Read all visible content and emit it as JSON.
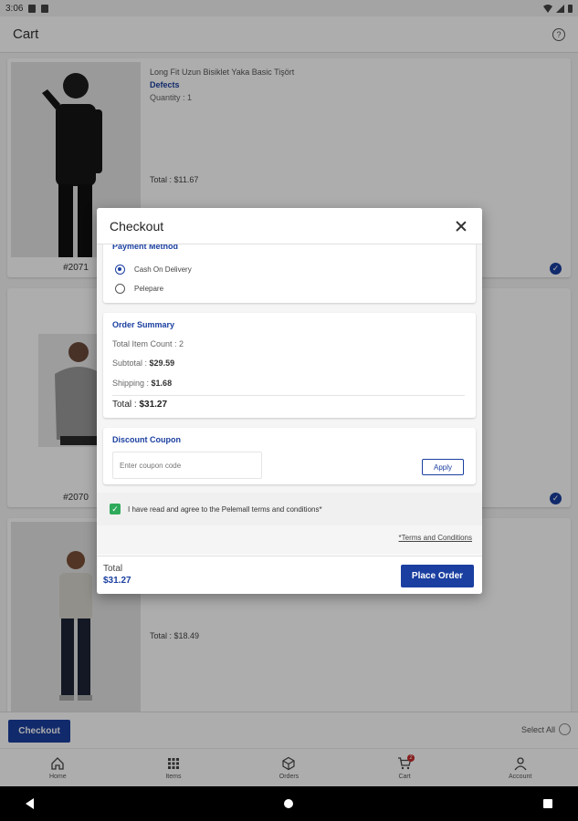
{
  "status_bar": {
    "time": "3:06"
  },
  "app_bar": {
    "title": "Cart",
    "help_icon": "help-circle-icon"
  },
  "cart": {
    "items": [
      {
        "id": "#2071",
        "name": "Long Fit Uzun Bisiklet Yaka Basic Tişört",
        "defects": "Defects",
        "quantity": "Quantity : 1",
        "total": "Total : $11.67",
        "selected": true
      },
      {
        "id": "#2070",
        "selected": true
      },
      {
        "total": "Total : $18.49"
      }
    ]
  },
  "bottom_action": {
    "checkout_label": "Checkout",
    "select_all_label": "Select All"
  },
  "nav": {
    "items": [
      {
        "label": "Home",
        "icon": "home-icon"
      },
      {
        "label": "Items",
        "icon": "grid-icon"
      },
      {
        "label": "Orders",
        "icon": "box-icon"
      },
      {
        "label": "Cart",
        "icon": "cart-icon",
        "badge": "2"
      },
      {
        "label": "Account",
        "icon": "person-icon"
      }
    ]
  },
  "checkout_dialog": {
    "title": "Checkout",
    "payment": {
      "title": "Payment Method",
      "options": [
        {
          "label": "Cash On Delivery",
          "selected": true
        },
        {
          "label": "Pelepare",
          "selected": false
        }
      ]
    },
    "summary": {
      "title": "Order Summary",
      "item_count_label": "Total Item Count : 2",
      "subtotal_label": "Subtotal :",
      "subtotal_value": "$29.59",
      "shipping_label": "Shipping :",
      "shipping_value": "$1.68",
      "total_label": "Total :",
      "total_value": "$31.27"
    },
    "coupon": {
      "title": "Discount Coupon",
      "placeholder": "Enter coupon code",
      "apply_label": "Apply"
    },
    "agreement_text": "I have read and agree to the Pelemall terms and conditions*",
    "terms_link": "*Terms and Conditions",
    "footer": {
      "total_label": "Total",
      "total_value": "$31.27",
      "place_order_label": "Place Order"
    }
  },
  "colors": {
    "primary": "#1a3fa0",
    "check_green": "#2eaa5a",
    "badge_red": "#c62828"
  }
}
